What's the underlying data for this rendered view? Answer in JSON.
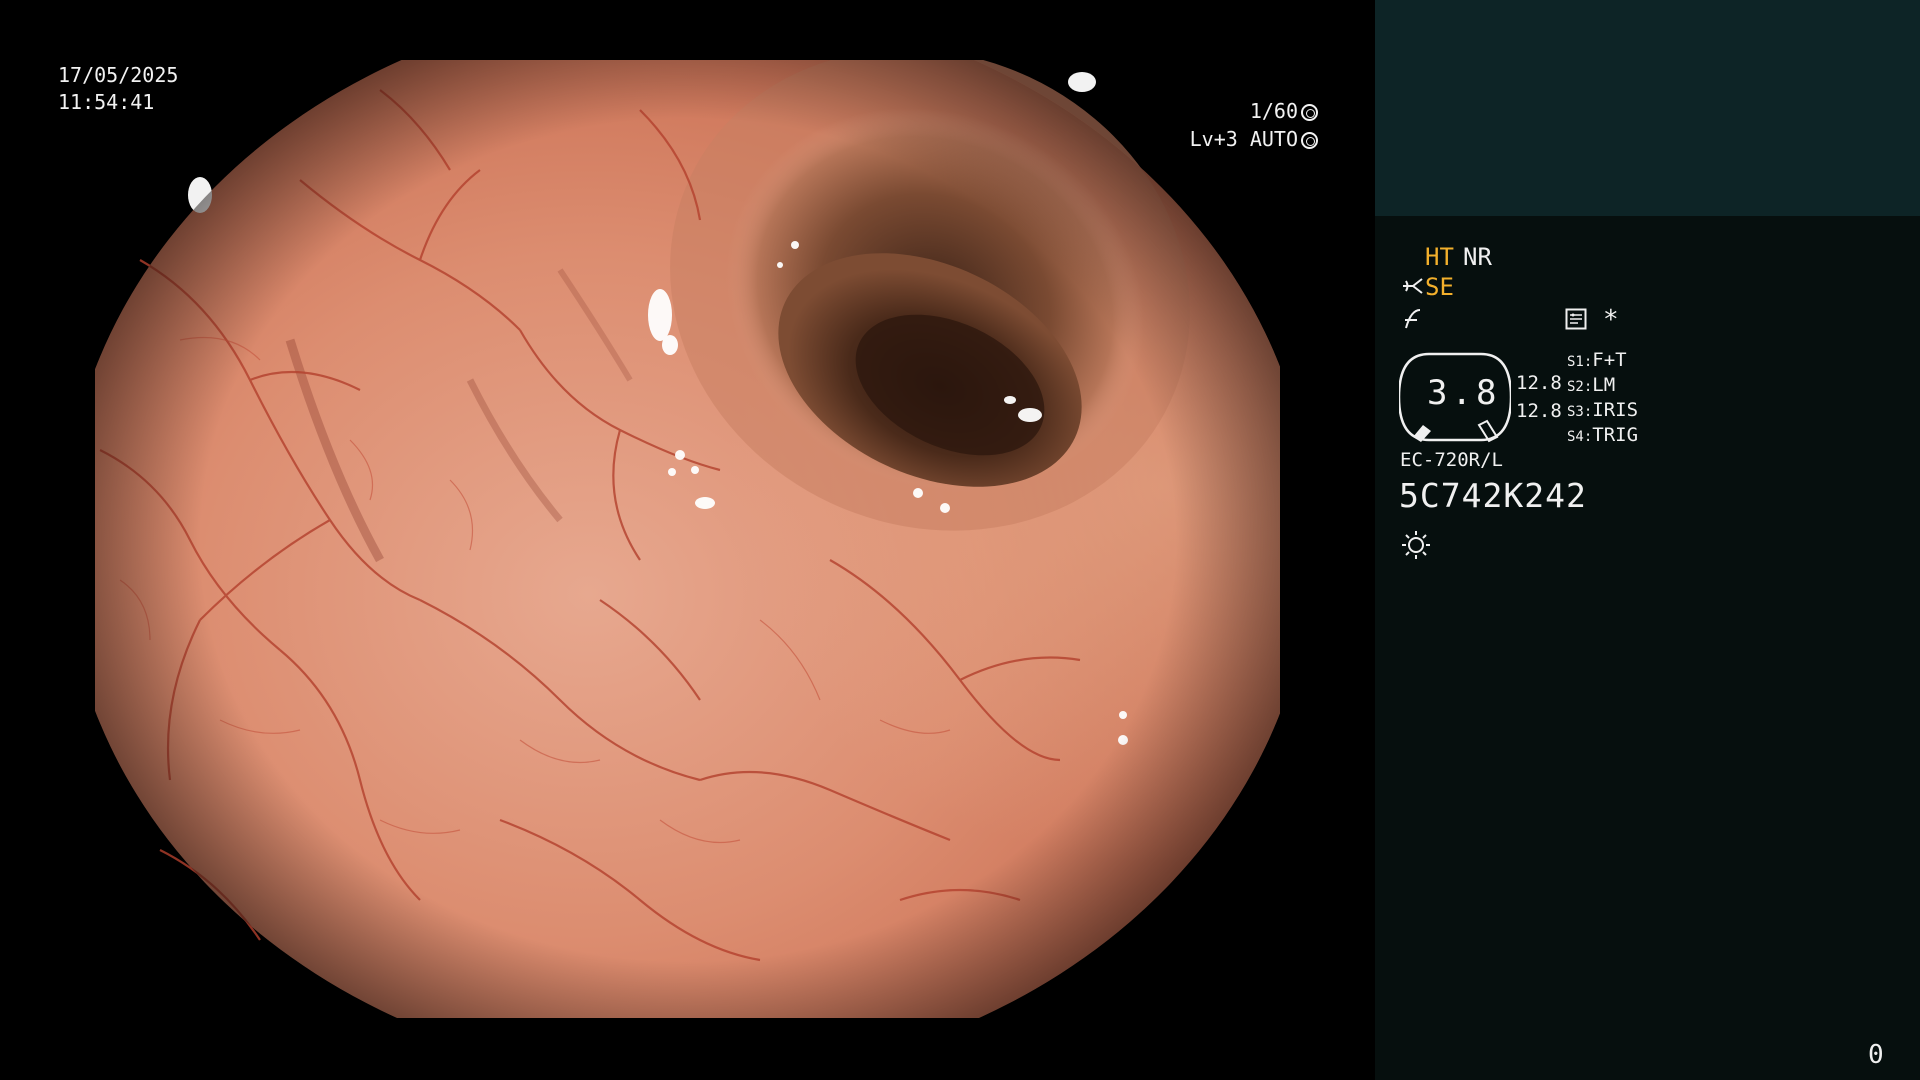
{
  "overlay": {
    "date": "17/05/2025",
    "time": "11:54:41",
    "shutter": "1/60",
    "level": "Lv+3 AUTO"
  },
  "panel": {
    "ht_label": "HT",
    "nr_label": "NR",
    "se_label": "SE",
    "star_label": "*",
    "zoom_value": "3.8",
    "gauge_values": [
      "12.8",
      "12.8"
    ],
    "switches": [
      {
        "key": "S1:",
        "label": "F+T"
      },
      {
        "key": "S2:",
        "label": "LM"
      },
      {
        "key": "S3:",
        "label": "IRIS"
      },
      {
        "key": "S4:",
        "label": "TRIG"
      }
    ],
    "scope_model": "EC-720R/L",
    "serial_number": "5C742K242",
    "page_counter": "0"
  },
  "colors": {
    "panel_bg": "#060f0e",
    "panel_top_block": "#0d2426",
    "amber_highlight": "#f3b02c",
    "text": "#f0f0f0"
  },
  "icons": [
    "shutter-icon",
    "iris-icon",
    "fork-icon",
    "enhance-icon",
    "record-icon",
    "zoom-badge-icon",
    "light-icon"
  ]
}
